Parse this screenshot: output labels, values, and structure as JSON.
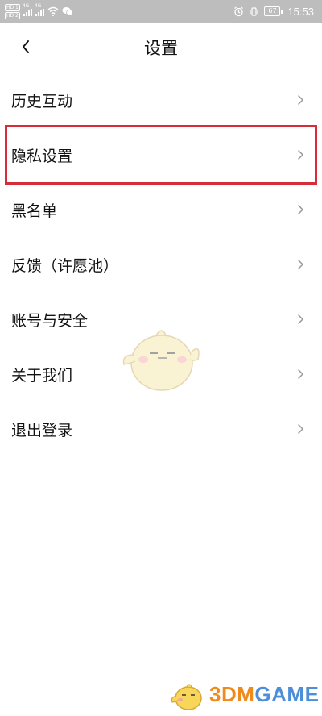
{
  "status_bar": {
    "hd_badge_1": "HD 1",
    "hd_badge_2": "HD 2",
    "signal_1_tag": "4G",
    "signal_2_tag": "4G",
    "battery": "67",
    "time": "15:53"
  },
  "header": {
    "title": "设置"
  },
  "menu": {
    "items": [
      {
        "label": "历史互动"
      },
      {
        "label": "隐私设置"
      },
      {
        "label": "黑名单"
      },
      {
        "label": "反馈（许愿池）"
      },
      {
        "label": "账号与安全"
      },
      {
        "label": "关于我们"
      },
      {
        "label": "退出登录"
      }
    ]
  },
  "highlight": {
    "color": "#d72d3a"
  },
  "watermark": {
    "prefix": "3DM",
    "suffix": "GAME"
  }
}
